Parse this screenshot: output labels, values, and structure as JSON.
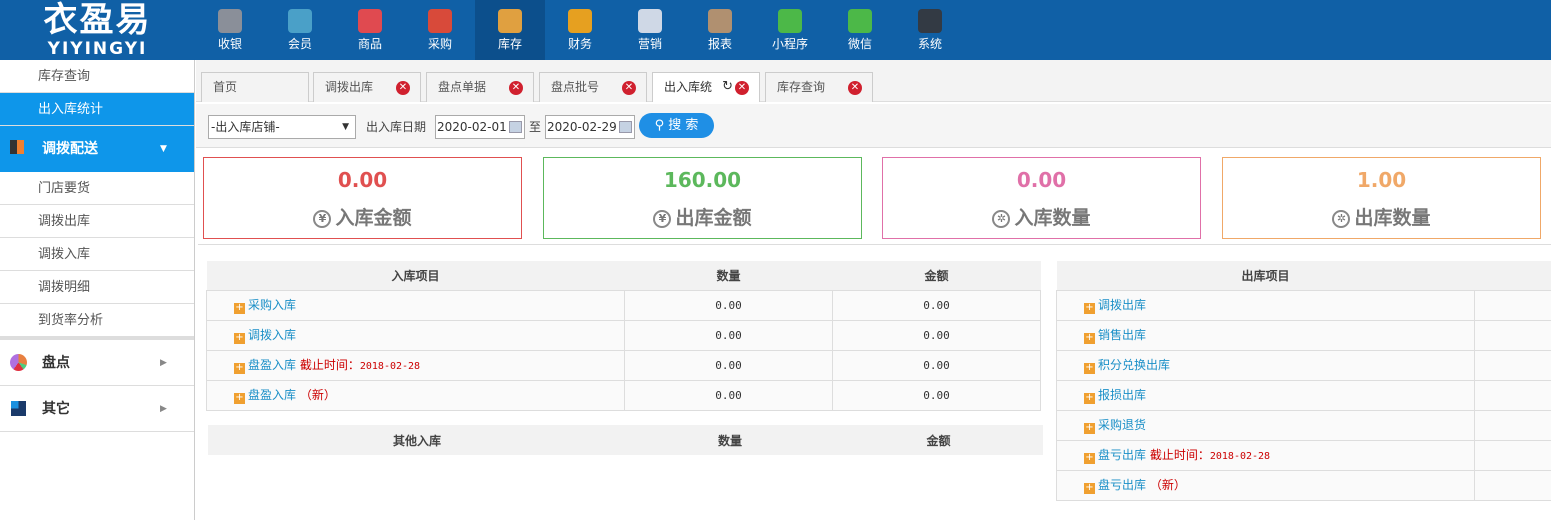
{
  "logo": {
    "cn": "衣盈易",
    "en": "YIYINGYI"
  },
  "nav": [
    {
      "label": "收银",
      "color": "#8a8f99"
    },
    {
      "label": "会员",
      "color": "#4aa0c8"
    },
    {
      "label": "商品",
      "color": "#e04a50"
    },
    {
      "label": "采购",
      "color": "#d84a3a"
    },
    {
      "label": "库存",
      "color": "#e0a040"
    },
    {
      "label": "财务",
      "color": "#e6a020"
    },
    {
      "label": "营销",
      "color": "#cfd8e6"
    },
    {
      "label": "报表",
      "color": "#b09070"
    },
    {
      "label": "小程序",
      "color": "#4cb848"
    },
    {
      "label": "微信",
      "color": "#4cb848"
    },
    {
      "label": "系统",
      "color": "#333a44"
    }
  ],
  "sidebar": {
    "items_top": [
      "库存查询",
      "出入库统计"
    ],
    "group": "调拨配送",
    "sub": [
      "门店要货",
      "调拨出库",
      "调拨入库",
      "调拨明细",
      "到货率分析"
    ],
    "groups": [
      "盘点",
      "其它"
    ]
  },
  "tabs": [
    "首页",
    "调拨出库",
    "盘点单据",
    "盘点批号",
    "出入库统",
    "库存查询"
  ],
  "filter": {
    "store": "-出入库店铺-",
    "date_label": "出入库日期",
    "start": "2020-02-01",
    "sep": "至",
    "end": "2020-02-29",
    "search": "搜 索"
  },
  "cards": [
    {
      "value": "0.00",
      "label": "入库金额",
      "icon": "¥",
      "color": "#e05050"
    },
    {
      "value": "160.00",
      "label": "出库金额",
      "icon": "¥",
      "color": "#5cb85c"
    },
    {
      "value": "0.00",
      "label": "入库数量",
      "icon": "✲",
      "color": "#e070a8"
    },
    {
      "value": "1.00",
      "label": "出库数量",
      "icon": "✲",
      "color": "#f0a868"
    }
  ],
  "in_table": {
    "headers": [
      "入库项目",
      "数量",
      "金额"
    ],
    "rows": [
      {
        "name": "采购入库",
        "note": "",
        "date": "",
        "qty": "0.00",
        "amt": "0.00"
      },
      {
        "name": "调拨入库",
        "note": "",
        "date": "",
        "qty": "0.00",
        "amt": "0.00"
      },
      {
        "name": "盘盈入库",
        "note": "截止时间：",
        "date": "2018-02-28",
        "qty": "0.00",
        "amt": "0.00"
      },
      {
        "name": "盘盈入库",
        "note": "（新）",
        "date": "",
        "qty": "0.00",
        "amt": "0.00"
      }
    ]
  },
  "other_table": {
    "headers": [
      "其他入库",
      "数量",
      "金额"
    ]
  },
  "out_table": {
    "headers": [
      "出库项目"
    ],
    "rows": [
      {
        "name": "调拨出库",
        "note": "",
        "date": ""
      },
      {
        "name": "销售出库",
        "note": "",
        "date": ""
      },
      {
        "name": "积分兑换出库",
        "note": "",
        "date": ""
      },
      {
        "name": "报损出库",
        "note": "",
        "date": ""
      },
      {
        "name": "采购退货",
        "note": "",
        "date": ""
      },
      {
        "name": "盘亏出库",
        "note": "截止时间：",
        "date": "2018-02-28"
      },
      {
        "name": "盘亏出库",
        "note": "（新）",
        "date": ""
      }
    ]
  }
}
